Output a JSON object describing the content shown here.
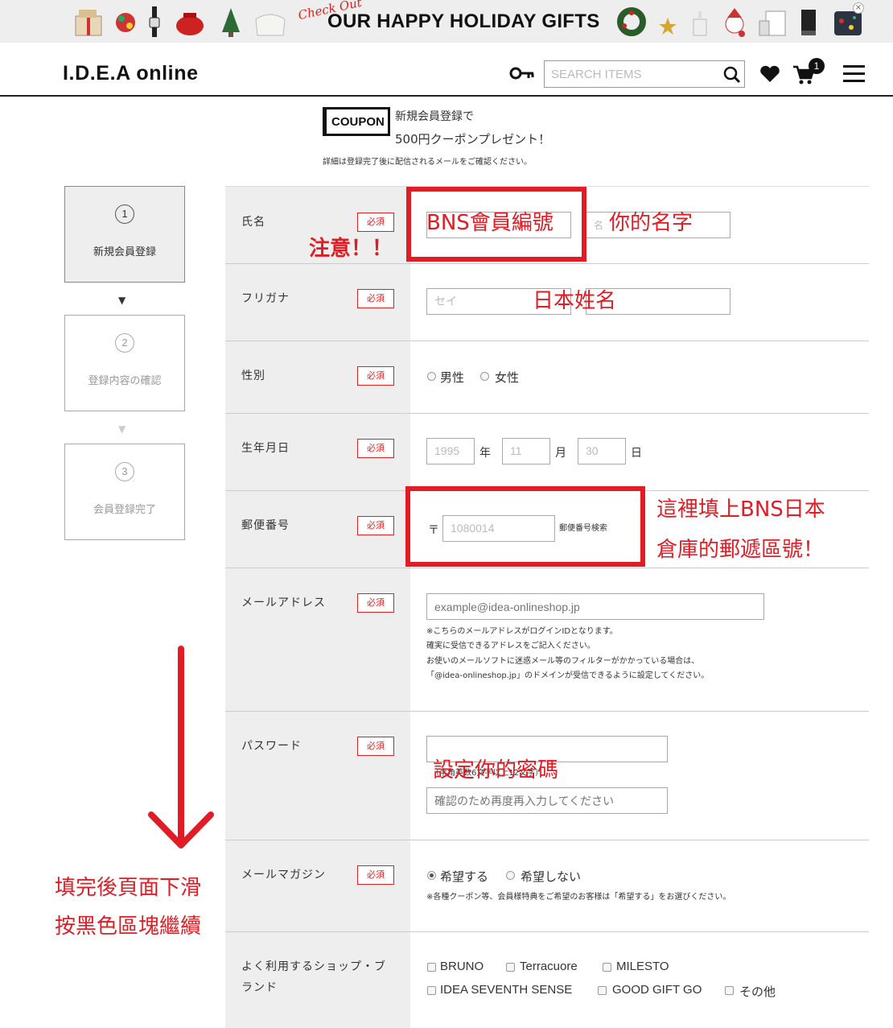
{
  "banner": {
    "check_out": "Check Out",
    "title": "OUR HAPPY HOLIDAY GIFTS",
    "close_symbol": "×",
    "gift_icons": [
      "gift-box-icon",
      "ornament-icon",
      "watch-icon",
      "pot-icon",
      "tree-icon",
      "bag-icon",
      "wreath-icon",
      "star-icon",
      "candle-icon",
      "santa-icon",
      "shelf-icon",
      "glove-icon",
      "pouch-icon"
    ]
  },
  "header": {
    "logo": "I.D.E.A online",
    "search_placeholder": "SEARCH ITEMS",
    "cart_count": "1"
  },
  "coupon": {
    "badge": "COUPON",
    "line1": "新規会員登録で",
    "line2": "500円クーポンプレゼント！",
    "note": "詳細は登録完了後に配信されるメールをご確認ください。"
  },
  "steps": [
    {
      "num": "1",
      "label": "新規会員登録"
    },
    {
      "num": "2",
      "label": "登録内容の確認"
    },
    {
      "num": "3",
      "label": "会員登録完了"
    }
  ],
  "step_arrow": "▼",
  "form": {
    "required": "必須",
    "name": {
      "label": "氏名",
      "first_prefix": "名"
    },
    "furigana": {
      "label": "フリガナ",
      "sei_placeholder": "セイ"
    },
    "gender": {
      "label": "性別",
      "options": [
        "男性",
        "女性"
      ]
    },
    "birthday": {
      "label": "生年月日",
      "year": "1995",
      "month": "11",
      "day": "30",
      "year_unit": "年",
      "month_unit": "月",
      "day_unit": "日"
    },
    "postal": {
      "label": "郵便番号",
      "mark": "〒",
      "value": "1080014",
      "search_link": "郵便番号検索"
    },
    "email": {
      "label": "メールアドレス",
      "placeholder": "example@idea-onlineshop.jp",
      "notes": [
        "※こちらのメールアドレスがログインIDとなります。",
        "確実に受信できるアドレスをご記入ください。",
        "お使いのメールソフトに迷惑メール等のフィルターがかかっている場合は、",
        "「@idea-onlineshop.jp」のドメインが受信できるように設定してください。"
      ]
    },
    "password": {
      "label": "パスワード",
      "hint": "（半角英数6文字以上12文字）",
      "confirm_placeholder": "確認のため再度再入力してください"
    },
    "magazine": {
      "label": "メールマガジン",
      "options": [
        "希望する",
        "希望しない"
      ],
      "note": "※各種クーポン等、会員様特典をご希望のお客様は「希望する」をお選びください。"
    },
    "shops": {
      "label_line1": "よく利用するショップ・ブ",
      "label_line2": "ランド",
      "options_row1": [
        "BRUNO",
        "Terracuore",
        "MILESTO"
      ],
      "options_row2": [
        "IDEA SEVENTH SENSE",
        "GOOD GIFT GO",
        "その他"
      ]
    }
  },
  "annotations": {
    "bns_member": "BNS會員編號",
    "your_name": "你的名字",
    "attention": "注意！！",
    "japanese_name": "日本姓名",
    "postal_line1": "這裡填上BNS日本",
    "postal_line2": "倉庫的郵遞區號！",
    "set_password": "設定你的密碼",
    "scroll_line1": "填完後頁面下滑",
    "scroll_line2": "按黑色區塊繼續"
  },
  "colors": {
    "annotation_red": "#e21c25",
    "required_red": "#dd2222",
    "label_bg": "#eeeeee"
  }
}
